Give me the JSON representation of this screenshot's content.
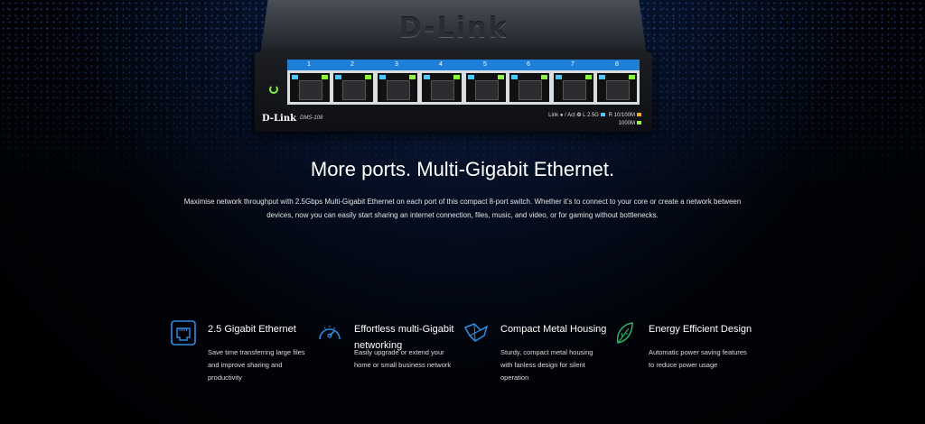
{
  "device": {
    "top_logo": "D-Link",
    "brand": "D-Link",
    "model": "DMS-108",
    "port_numbers": [
      "1",
      "2",
      "3",
      "4",
      "5",
      "6",
      "7",
      "8"
    ],
    "legend_line1": "Link ● / Act ❂  L 2.5G",
    "legend_r": "R 10/100M",
    "legend_line2": "1000M"
  },
  "headline": "More ports. Multi-Gigabit Ethernet.",
  "intro": "Maximise network throughput with 2.5Gbps Multi-Gigabit Ethernet on each port of this compact 8-port switch. Whether it’s to connect to your core or create a network between devices, now you can easily start sharing an internet connection, files, music, and video, or for gaming without bottlenecks.",
  "features": [
    {
      "icon": "ethernet-port-icon",
      "title": "2.5 Gigabit Ethernet",
      "desc": "Save time transferring large files and improve sharing and productivity"
    },
    {
      "icon": "speedometer-icon",
      "title": "Effortless multi-Gigabit networking",
      "desc": "Easily upgrade or extend your home or small business network"
    },
    {
      "icon": "metal-housing-icon",
      "title": "Compact Metal Housing",
      "desc": "Sturdy, compact metal housing with fanless design for silent operation"
    },
    {
      "icon": "leaf-icon",
      "title": "Energy Efficient Design",
      "desc": "Automatic power saving features to reduce power usage"
    }
  ],
  "colors": {
    "accent_blue": "#1d7fd8",
    "icon_blue": "#2f8de4",
    "icon_green": "#2db36b",
    "led_green": "#8cf53c"
  }
}
